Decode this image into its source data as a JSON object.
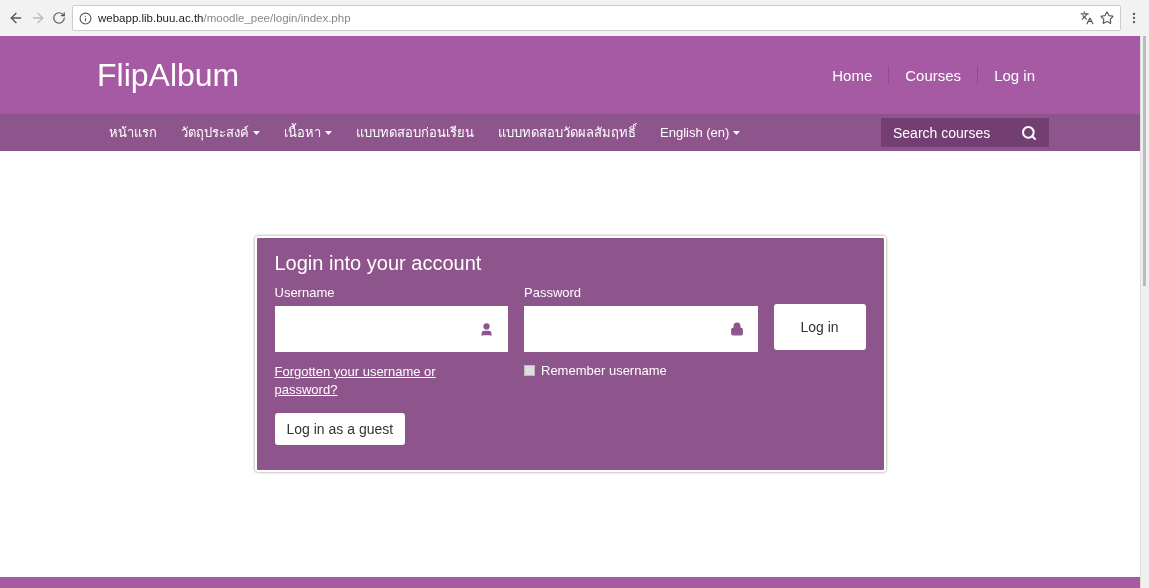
{
  "browser": {
    "url_host": "webapp.lib.buu.ac.th",
    "url_path": "/moodle_pee/login/index.php"
  },
  "header": {
    "logo": "FlipAlbum",
    "links": [
      {
        "label": "Home"
      },
      {
        "label": "Courses"
      },
      {
        "label": "Log in"
      }
    ]
  },
  "nav": {
    "items": [
      {
        "label": "หน้าแรก",
        "kind": "link"
      },
      {
        "label": "วัตถุประสงค์",
        "kind": "dropdown"
      },
      {
        "label": "เนื้อหา",
        "kind": "dropdown"
      },
      {
        "label": "แบบทดสอบก่อนเรียน",
        "kind": "link"
      },
      {
        "label": "แบบทดสอบวัดผลสัมฤทธิ์",
        "kind": "link"
      },
      {
        "label": "English (en)",
        "kind": "dropdown"
      }
    ],
    "search": {
      "placeholder": "Search courses"
    }
  },
  "login": {
    "title": "Login into your account",
    "username_label": "Username",
    "password_label": "Password",
    "submit": "Log in",
    "forgot_link": "Forgotten your username or password?",
    "remember": {
      "label": "Remember username",
      "checked": false
    },
    "guest_button": "Log in as a guest"
  }
}
